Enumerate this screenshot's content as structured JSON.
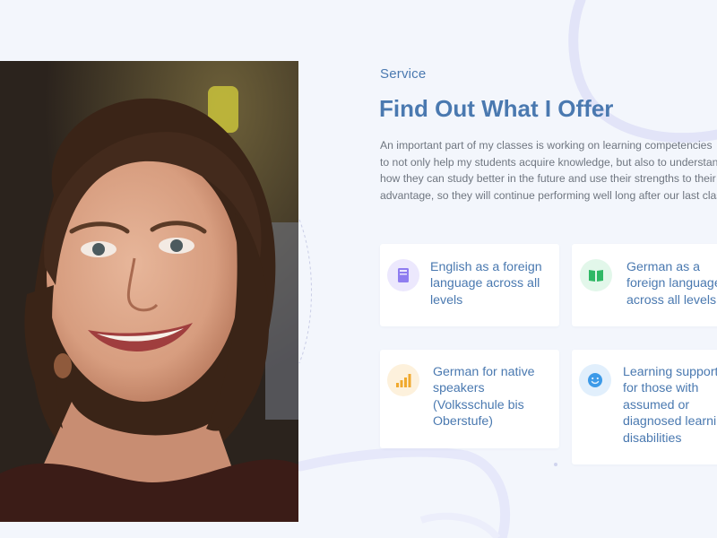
{
  "section": {
    "eyebrow": "Service",
    "title": "Find Out What I Offer",
    "description_lines": [
      "An important part of my classes is working on learning competencies",
      "to not only help my students acquire knowledge, but also to understand",
      "how they can study better in the future and use their strengths to their",
      "advantage, so they will continue performing well long after our last class."
    ]
  },
  "photo": {
    "alt": "Smiling woman with curly brown hair"
  },
  "services": [
    {
      "lines": [
        "English as a foreign",
        "language across all",
        "levels"
      ],
      "icon": "book-icon",
      "icon_color": "#8f7df0",
      "icon_bg": "#ece8fd"
    },
    {
      "lines": [
        "German as a",
        "foreign language",
        "across all levels"
      ],
      "icon": "open-book-icon",
      "icon_color": "#2fb865",
      "icon_bg": "#e2f7ea"
    },
    {
      "lines": [
        "German for native",
        "speakers",
        "(Volksschule bis",
        "Oberstufe)"
      ],
      "icon": "signal-bars-icon",
      "icon_color": "#f0a92e",
      "icon_bg": "#fdf1dc"
    },
    {
      "lines": [
        "Learning support",
        "for those with",
        "assumed or",
        "diagnosed learning",
        "disabilities"
      ],
      "icon": "smiley-icon",
      "icon_color": "#3c9ae8",
      "icon_bg": "#e1effc"
    }
  ],
  "colors": {
    "accent": "#4a79b0",
    "background": "#f3f6fc",
    "body_text": "#6f7680",
    "card": "#ffffff"
  }
}
